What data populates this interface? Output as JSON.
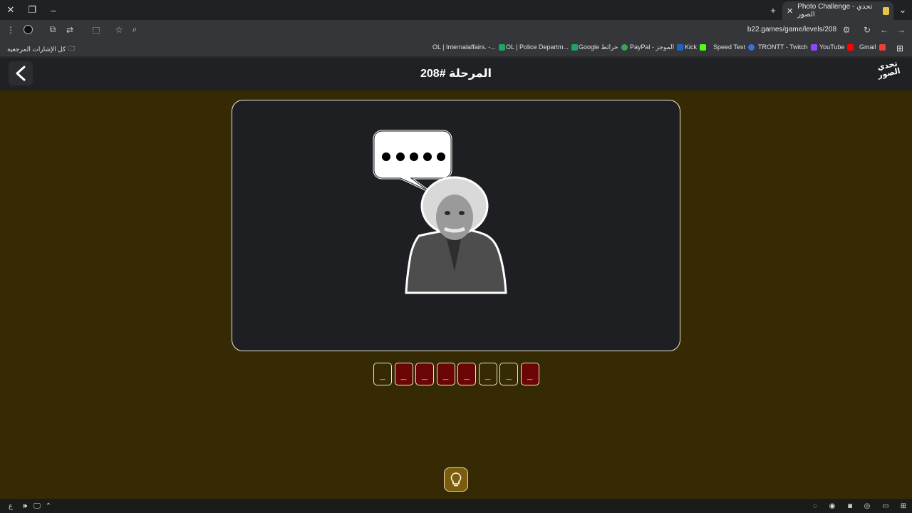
{
  "browser": {
    "tab_title": "Photo Challenge - تحدي الصور",
    "url": "b22.games/game/levels/208",
    "bookmarks_folder": "كل الإشارات المرجعية",
    "bookmarks": [
      {
        "label": "OL | Internalaffairs. -...",
        "color": "#21a366"
      },
      {
        "label": "OL | Police Departm...",
        "color": "#21a366"
      },
      {
        "label": "Google خرائط",
        "color": "#34a853"
      },
      {
        "label": "PayPal - الموجز",
        "color": "#1e63c6"
      },
      {
        "label": "Kick",
        "color": "#53fc18"
      },
      {
        "label": "Speed Test",
        "color": "#3b6fe0"
      },
      {
        "label": "TRONTT - Twitch",
        "color": "#9146ff"
      },
      {
        "label": "YouTube",
        "color": "#ff0000"
      },
      {
        "label": "Gmail",
        "color": "#ea4335"
      }
    ]
  },
  "game": {
    "level_title": "المرحلة #208",
    "logo_line1": "تحدي",
    "logo_line2": "الصور",
    "tiles": [
      {
        "char": "_",
        "state": "empty"
      },
      {
        "char": "_",
        "state": "filled"
      },
      {
        "char": "_",
        "state": "filled"
      },
      {
        "char": "_",
        "state": "filled"
      },
      {
        "char": "_",
        "state": "filled"
      },
      {
        "char": "_",
        "state": "empty"
      },
      {
        "char": "_",
        "state": "empty"
      },
      {
        "char": "_",
        "state": "filled"
      }
    ]
  },
  "taskbar": {
    "lang": "ع"
  },
  "colors": {
    "background": "#352a03",
    "card": "#1d1f22",
    "tile_filled": "#6b0606",
    "hint_button": "#7a5c0e"
  }
}
